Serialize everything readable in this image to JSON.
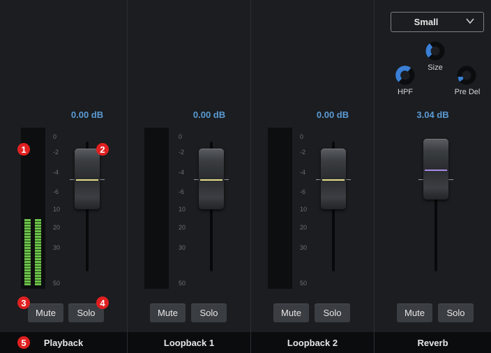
{
  "channels": [
    {
      "name": "Playback",
      "db": "0.00 dB",
      "mute": "Mute",
      "solo": "Solo",
      "meter_level": 0.43
    },
    {
      "name": "Loopback 1",
      "db": "0.00 dB",
      "mute": "Mute",
      "solo": "Solo",
      "meter_level": 0
    },
    {
      "name": "Loopback 2",
      "db": "0.00 dB",
      "mute": "Mute",
      "solo": "Solo",
      "meter_level": 0
    },
    {
      "name": "Reverb",
      "db": "3.04 dB",
      "mute": "Mute",
      "solo": "Solo"
    }
  ],
  "scale_labels": [
    "0",
    "-2",
    "-4",
    "-6",
    "10",
    "20",
    "30",
    "50"
  ],
  "reverb": {
    "size_option": "Small",
    "knobs": [
      {
        "label": "Size",
        "color": "#3a7fd5"
      },
      {
        "label": "HPF",
        "color": "#3a7fd5"
      },
      {
        "label": "Pre Del",
        "color": "#3a7fd5"
      }
    ]
  },
  "badges": [
    "1",
    "2",
    "3",
    "4",
    "5"
  ],
  "colors": {
    "accent": "#5b9bd5",
    "meter": "#6cc24a",
    "badge": "#e02020",
    "fader_line": "#e8e08a",
    "reverb_fader_line": "#a88ce8"
  }
}
